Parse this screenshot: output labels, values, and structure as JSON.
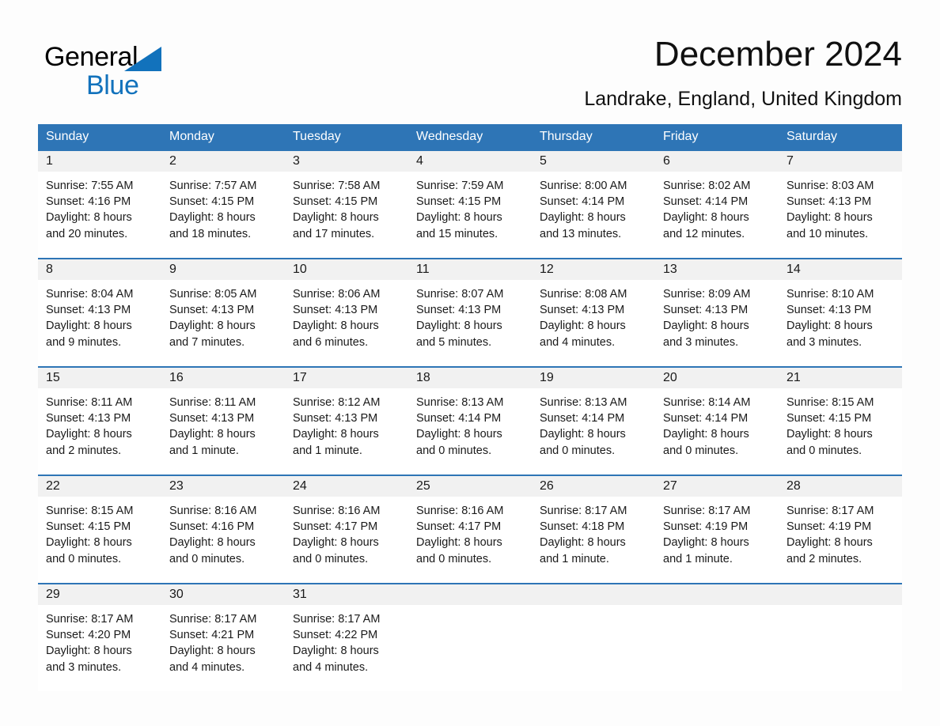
{
  "brand": {
    "name_part1": "General",
    "name_part2": "Blue",
    "triangle_icon": "blue-triangle-icon",
    "accent_color": "#1272BC"
  },
  "header": {
    "title": "December 2024",
    "location": "Landrake, England, United Kingdom"
  },
  "calendar": {
    "header_bg": "#2E75B6",
    "header_text_color": "#FFFFFF",
    "daynum_bg": "#F1F1F1",
    "weekday_headers": [
      "Sunday",
      "Monday",
      "Tuesday",
      "Wednesday",
      "Thursday",
      "Friday",
      "Saturday"
    ],
    "weeks": [
      [
        {
          "day": "1",
          "sunrise": "Sunrise: 7:55 AM",
          "sunset": "Sunset: 4:16 PM",
          "daylight_l1": "Daylight: 8 hours",
          "daylight_l2": "and 20 minutes."
        },
        {
          "day": "2",
          "sunrise": "Sunrise: 7:57 AM",
          "sunset": "Sunset: 4:15 PM",
          "daylight_l1": "Daylight: 8 hours",
          "daylight_l2": "and 18 minutes."
        },
        {
          "day": "3",
          "sunrise": "Sunrise: 7:58 AM",
          "sunset": "Sunset: 4:15 PM",
          "daylight_l1": "Daylight: 8 hours",
          "daylight_l2": "and 17 minutes."
        },
        {
          "day": "4",
          "sunrise": "Sunrise: 7:59 AM",
          "sunset": "Sunset: 4:15 PM",
          "daylight_l1": "Daylight: 8 hours",
          "daylight_l2": "and 15 minutes."
        },
        {
          "day": "5",
          "sunrise": "Sunrise: 8:00 AM",
          "sunset": "Sunset: 4:14 PM",
          "daylight_l1": "Daylight: 8 hours",
          "daylight_l2": "and 13 minutes."
        },
        {
          "day": "6",
          "sunrise": "Sunrise: 8:02 AM",
          "sunset": "Sunset: 4:14 PM",
          "daylight_l1": "Daylight: 8 hours",
          "daylight_l2": "and 12 minutes."
        },
        {
          "day": "7",
          "sunrise": "Sunrise: 8:03 AM",
          "sunset": "Sunset: 4:13 PM",
          "daylight_l1": "Daylight: 8 hours",
          "daylight_l2": "and 10 minutes."
        }
      ],
      [
        {
          "day": "8",
          "sunrise": "Sunrise: 8:04 AM",
          "sunset": "Sunset: 4:13 PM",
          "daylight_l1": "Daylight: 8 hours",
          "daylight_l2": "and 9 minutes."
        },
        {
          "day": "9",
          "sunrise": "Sunrise: 8:05 AM",
          "sunset": "Sunset: 4:13 PM",
          "daylight_l1": "Daylight: 8 hours",
          "daylight_l2": "and 7 minutes."
        },
        {
          "day": "10",
          "sunrise": "Sunrise: 8:06 AM",
          "sunset": "Sunset: 4:13 PM",
          "daylight_l1": "Daylight: 8 hours",
          "daylight_l2": "and 6 minutes."
        },
        {
          "day": "11",
          "sunrise": "Sunrise: 8:07 AM",
          "sunset": "Sunset: 4:13 PM",
          "daylight_l1": "Daylight: 8 hours",
          "daylight_l2": "and 5 minutes."
        },
        {
          "day": "12",
          "sunrise": "Sunrise: 8:08 AM",
          "sunset": "Sunset: 4:13 PM",
          "daylight_l1": "Daylight: 8 hours",
          "daylight_l2": "and 4 minutes."
        },
        {
          "day": "13",
          "sunrise": "Sunrise: 8:09 AM",
          "sunset": "Sunset: 4:13 PM",
          "daylight_l1": "Daylight: 8 hours",
          "daylight_l2": "and 3 minutes."
        },
        {
          "day": "14",
          "sunrise": "Sunrise: 8:10 AM",
          "sunset": "Sunset: 4:13 PM",
          "daylight_l1": "Daylight: 8 hours",
          "daylight_l2": "and 3 minutes."
        }
      ],
      [
        {
          "day": "15",
          "sunrise": "Sunrise: 8:11 AM",
          "sunset": "Sunset: 4:13 PM",
          "daylight_l1": "Daylight: 8 hours",
          "daylight_l2": "and 2 minutes."
        },
        {
          "day": "16",
          "sunrise": "Sunrise: 8:11 AM",
          "sunset": "Sunset: 4:13 PM",
          "daylight_l1": "Daylight: 8 hours",
          "daylight_l2": "and 1 minute."
        },
        {
          "day": "17",
          "sunrise": "Sunrise: 8:12 AM",
          "sunset": "Sunset: 4:13 PM",
          "daylight_l1": "Daylight: 8 hours",
          "daylight_l2": "and 1 minute."
        },
        {
          "day": "18",
          "sunrise": "Sunrise: 8:13 AM",
          "sunset": "Sunset: 4:14 PM",
          "daylight_l1": "Daylight: 8 hours",
          "daylight_l2": "and 0 minutes."
        },
        {
          "day": "19",
          "sunrise": "Sunrise: 8:13 AM",
          "sunset": "Sunset: 4:14 PM",
          "daylight_l1": "Daylight: 8 hours",
          "daylight_l2": "and 0 minutes."
        },
        {
          "day": "20",
          "sunrise": "Sunrise: 8:14 AM",
          "sunset": "Sunset: 4:14 PM",
          "daylight_l1": "Daylight: 8 hours",
          "daylight_l2": "and 0 minutes."
        },
        {
          "day": "21",
          "sunrise": "Sunrise: 8:15 AM",
          "sunset": "Sunset: 4:15 PM",
          "daylight_l1": "Daylight: 8 hours",
          "daylight_l2": "and 0 minutes."
        }
      ],
      [
        {
          "day": "22",
          "sunrise": "Sunrise: 8:15 AM",
          "sunset": "Sunset: 4:15 PM",
          "daylight_l1": "Daylight: 8 hours",
          "daylight_l2": "and 0 minutes."
        },
        {
          "day": "23",
          "sunrise": "Sunrise: 8:16 AM",
          "sunset": "Sunset: 4:16 PM",
          "daylight_l1": "Daylight: 8 hours",
          "daylight_l2": "and 0 minutes."
        },
        {
          "day": "24",
          "sunrise": "Sunrise: 8:16 AM",
          "sunset": "Sunset: 4:17 PM",
          "daylight_l1": "Daylight: 8 hours",
          "daylight_l2": "and 0 minutes."
        },
        {
          "day": "25",
          "sunrise": "Sunrise: 8:16 AM",
          "sunset": "Sunset: 4:17 PM",
          "daylight_l1": "Daylight: 8 hours",
          "daylight_l2": "and 0 minutes."
        },
        {
          "day": "26",
          "sunrise": "Sunrise: 8:17 AM",
          "sunset": "Sunset: 4:18 PM",
          "daylight_l1": "Daylight: 8 hours",
          "daylight_l2": "and 1 minute."
        },
        {
          "day": "27",
          "sunrise": "Sunrise: 8:17 AM",
          "sunset": "Sunset: 4:19 PM",
          "daylight_l1": "Daylight: 8 hours",
          "daylight_l2": "and 1 minute."
        },
        {
          "day": "28",
          "sunrise": "Sunrise: 8:17 AM",
          "sunset": "Sunset: 4:19 PM",
          "daylight_l1": "Daylight: 8 hours",
          "daylight_l2": "and 2 minutes."
        }
      ],
      [
        {
          "day": "29",
          "sunrise": "Sunrise: 8:17 AM",
          "sunset": "Sunset: 4:20 PM",
          "daylight_l1": "Daylight: 8 hours",
          "daylight_l2": "and 3 minutes."
        },
        {
          "day": "30",
          "sunrise": "Sunrise: 8:17 AM",
          "sunset": "Sunset: 4:21 PM",
          "daylight_l1": "Daylight: 8 hours",
          "daylight_l2": "and 4 minutes."
        },
        {
          "day": "31",
          "sunrise": "Sunrise: 8:17 AM",
          "sunset": "Sunset: 4:22 PM",
          "daylight_l1": "Daylight: 8 hours",
          "daylight_l2": "and 4 minutes."
        },
        {
          "day": "",
          "sunrise": "",
          "sunset": "",
          "daylight_l1": "",
          "daylight_l2": ""
        },
        {
          "day": "",
          "sunrise": "",
          "sunset": "",
          "daylight_l1": "",
          "daylight_l2": ""
        },
        {
          "day": "",
          "sunrise": "",
          "sunset": "",
          "daylight_l1": "",
          "daylight_l2": ""
        },
        {
          "day": "",
          "sunrise": "",
          "sunset": "",
          "daylight_l1": "",
          "daylight_l2": ""
        }
      ]
    ]
  }
}
